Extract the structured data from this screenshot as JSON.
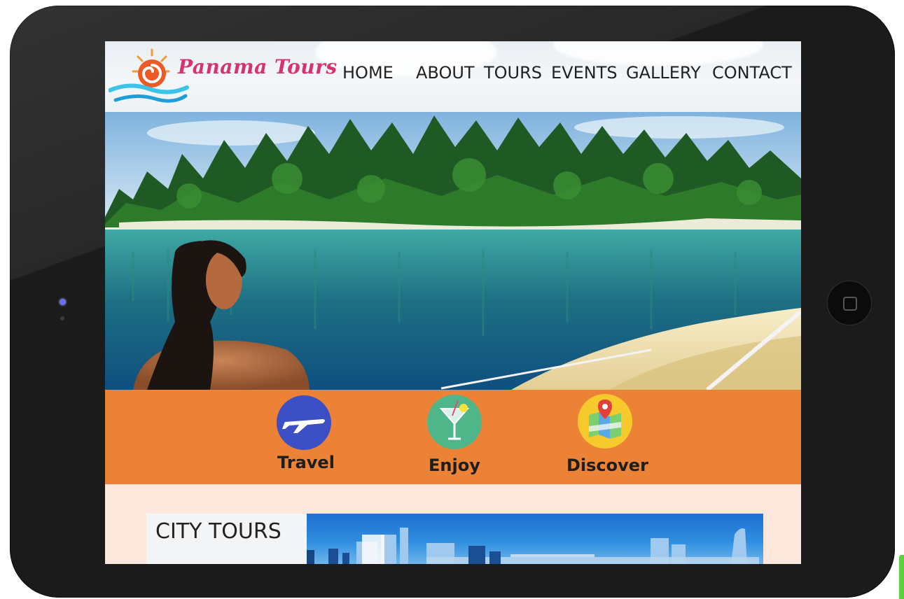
{
  "site": {
    "brand": "Panama Tours",
    "nav": [
      "HOME",
      "ABOUT",
      "TOURS",
      "EVENTS",
      "GALLERY",
      "CONTACT"
    ]
  },
  "features": [
    {
      "label": "Travel",
      "icon": "airplane-icon",
      "color": "#3d4fc4"
    },
    {
      "label": "Enjoy",
      "icon": "cocktail-icon",
      "color": "#4fb68a"
    },
    {
      "label": "Discover",
      "icon": "map-pin-icon",
      "color": "#f6c92d"
    }
  ],
  "city_section": {
    "title": "CITY TOURS"
  },
  "colors": {
    "accent_orange": "#ec8235",
    "brand_pink": "#d6336c",
    "page_bg": "#fbe7db",
    "frame": "#1b1b1b"
  }
}
